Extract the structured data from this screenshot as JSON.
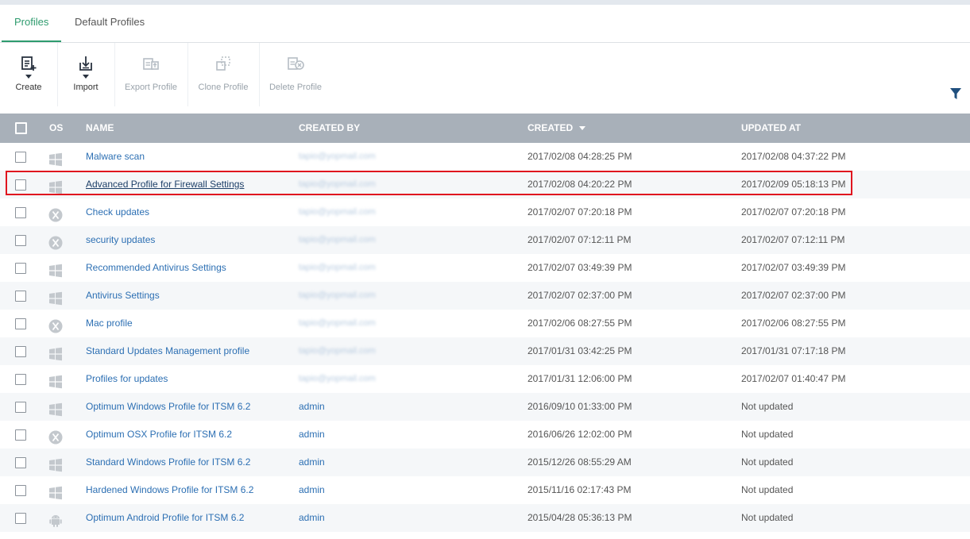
{
  "tabs": [
    {
      "label": "Profiles",
      "active": true
    },
    {
      "label": "Default Profiles",
      "active": false
    }
  ],
  "toolbar": {
    "create": "Create",
    "import": "Import",
    "export": "Export Profile",
    "clone": "Clone Profile",
    "delete": "Delete Profile"
  },
  "table": {
    "headers": {
      "os": "OS",
      "name": "NAME",
      "created_by": "CREATED BY",
      "created": "CREATED",
      "updated_at": "UPDATED AT"
    },
    "rows": [
      {
        "os": "windows",
        "name": "Malware scan",
        "created_by": "tapio@yopmail.com",
        "created": "2017/02/08 04:28:25 PM",
        "updated": "2017/02/08 04:37:22 PM"
      },
      {
        "os": "windows",
        "name": "Advanced Profile for Firewall Settings",
        "created_by": "tapio@yopmail.com",
        "created": "2017/02/08 04:20:22 PM",
        "updated": "2017/02/09 05:18:13 PM"
      },
      {
        "os": "mac",
        "name": "Check updates",
        "created_by": "tapio@yopmail.com",
        "created": "2017/02/07 07:20:18 PM",
        "updated": "2017/02/07 07:20:18 PM"
      },
      {
        "os": "mac",
        "name": "security updates",
        "created_by": "tapio@yopmail.com",
        "created": "2017/02/07 07:12:11 PM",
        "updated": "2017/02/07 07:12:11 PM"
      },
      {
        "os": "windows",
        "name": "Recommended Antivirus Settings",
        "created_by": "tapio@yopmail.com",
        "created": "2017/02/07 03:49:39 PM",
        "updated": "2017/02/07 03:49:39 PM"
      },
      {
        "os": "windows",
        "name": "Antivirus Settings",
        "created_by": "tapio@yopmail.com",
        "created": "2017/02/07 02:37:00 PM",
        "updated": "2017/02/07 02:37:00 PM"
      },
      {
        "os": "mac",
        "name": "Mac profile",
        "created_by": "tapio@yopmail.com",
        "created": "2017/02/06 08:27:55 PM",
        "updated": "2017/02/06 08:27:55 PM"
      },
      {
        "os": "windows",
        "name": "Standard Updates Management profile",
        "created_by": "tapio@yopmail.com",
        "created": "2017/01/31 03:42:25 PM",
        "updated": "2017/01/31 07:17:18 PM"
      },
      {
        "os": "windows",
        "name": "Profiles for updates",
        "created_by": "tapio@yopmail.com",
        "created": "2017/01/31 12:06:00 PM",
        "updated": "2017/02/07 01:40:47 PM"
      },
      {
        "os": "windows",
        "name": "Optimum Windows Profile for ITSM 6.2",
        "created_by": "admin",
        "created": "2016/09/10 01:33:00 PM",
        "updated": "Not updated"
      },
      {
        "os": "mac",
        "name": "Optimum OSX Profile for ITSM 6.2",
        "created_by": "admin",
        "created": "2016/06/26 12:02:00 PM",
        "updated": "Not updated"
      },
      {
        "os": "windows",
        "name": "Standard Windows Profile for ITSM 6.2",
        "created_by": "admin",
        "created": "2015/12/26 08:55:29 AM",
        "updated": "Not updated"
      },
      {
        "os": "windows",
        "name": "Hardened Windows Profile for ITSM 6.2",
        "created_by": "admin",
        "created": "2015/11/16 02:17:43 PM",
        "updated": "Not updated"
      },
      {
        "os": "android",
        "name": "Optimum Android Profile for ITSM 6.2",
        "created_by": "admin",
        "created": "2015/04/28 05:36:13 PM",
        "updated": "Not updated"
      }
    ]
  },
  "colors": {
    "accent": "#2e9b6e",
    "link": "#2c6fb3",
    "header_bg": "#a8b0b9",
    "highlight": "#e0151f"
  },
  "icons": {
    "create": "create-profile-icon",
    "import": "import-icon",
    "export": "export-icon",
    "clone": "clone-icon",
    "delete": "delete-icon",
    "filter": "filter-icon"
  }
}
